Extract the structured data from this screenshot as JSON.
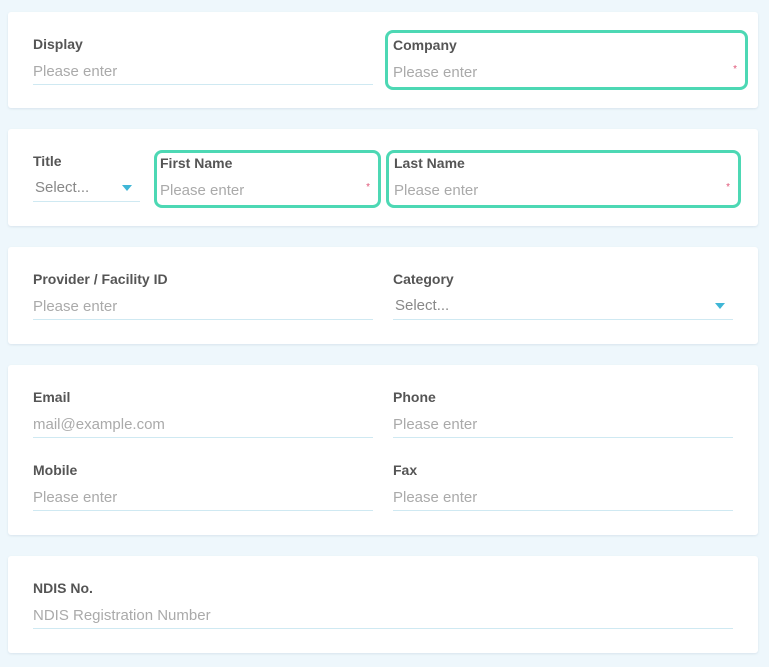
{
  "card1": {
    "display": {
      "label": "Display",
      "placeholder": "Please enter"
    },
    "company": {
      "label": "Company",
      "placeholder": "Please enter",
      "required": "*"
    }
  },
  "card2": {
    "title": {
      "label": "Title",
      "value": "Select..."
    },
    "first_name": {
      "label": "First Name",
      "placeholder": "Please enter",
      "required": "*"
    },
    "last_name": {
      "label": "Last Name",
      "placeholder": "Please enter",
      "required": "*"
    }
  },
  "card3": {
    "provider_id": {
      "label": "Provider / Facility ID",
      "placeholder": "Please enter"
    },
    "category": {
      "label": "Category",
      "value": "Select..."
    }
  },
  "card4": {
    "email": {
      "label": "Email",
      "placeholder": "mail@example.com"
    },
    "phone": {
      "label": "Phone",
      "placeholder": "Please enter"
    },
    "mobile": {
      "label": "Mobile",
      "placeholder": "Please enter"
    },
    "fax": {
      "label": "Fax",
      "placeholder": "Please enter"
    }
  },
  "card5": {
    "ndis": {
      "label": "NDIS No.",
      "placeholder": "NDIS Registration Number"
    }
  },
  "colors": {
    "highlight": "#4dd8b4",
    "required": "#e05577",
    "caret": "#3fb6d6",
    "background": "#eef7fc"
  }
}
